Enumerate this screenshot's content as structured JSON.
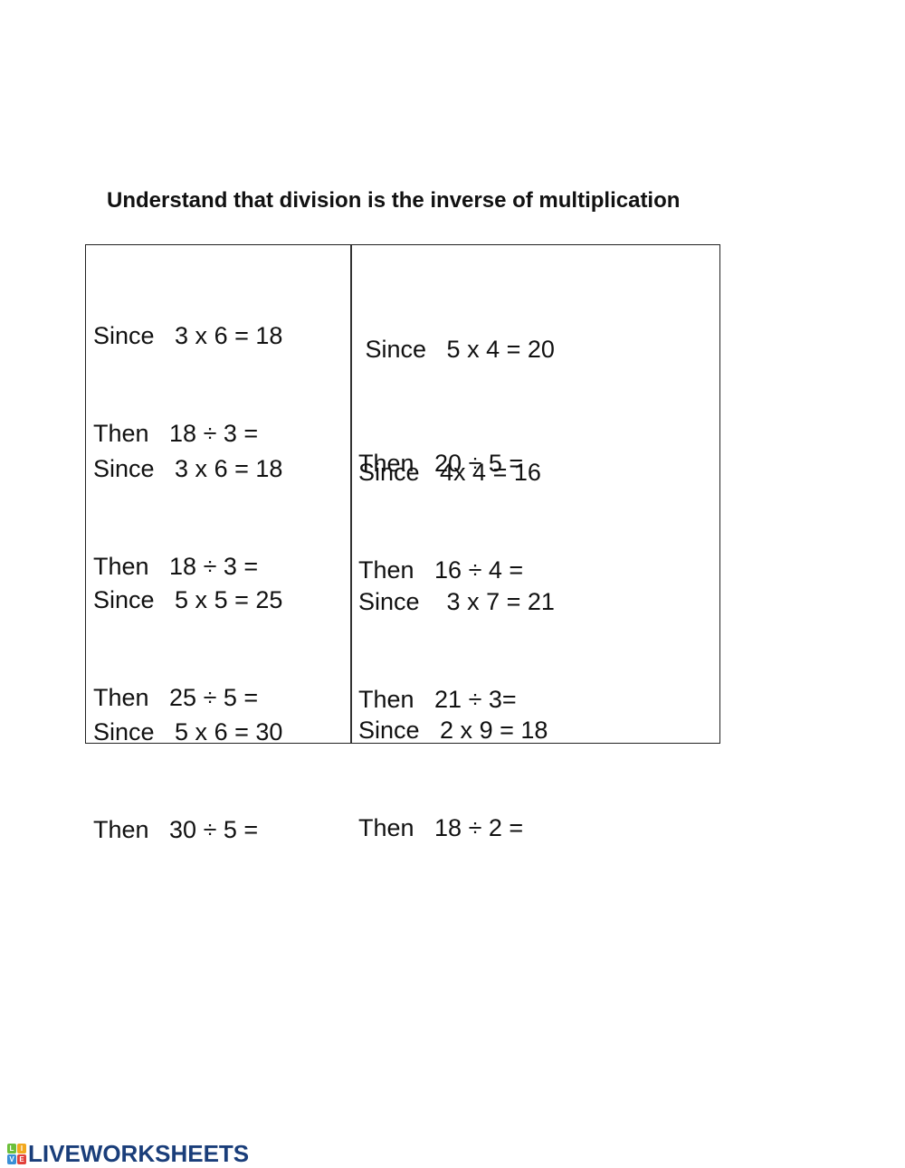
{
  "worksheet": {
    "title": "Understand that division is the inverse of multiplication",
    "left_column": [
      {
        "since": "Since   3 x 6 = 18",
        "then": "Then   18 ÷ 3 ="
      },
      {
        "since": "Since   3 x 6 = 18",
        "then": "Then   18 ÷ 3 ="
      },
      {
        "since": "Since   5 x 5 = 25",
        "then": "Then   25 ÷ 5 ="
      },
      {
        "since": "Since   5 x 6 = 30",
        "then": "Then   30 ÷ 5 ="
      }
    ],
    "right_column": [
      {
        "since": " Since   5 x 4 = 20",
        "then": "Then   20 ÷ 5 ="
      },
      {
        "since": "Since   4x 4 = 16",
        "then": "Then   16 ÷ 4 ="
      },
      {
        "since": "Since    3 x 7 = 21",
        "then": "Then   21 ÷ 3="
      },
      {
        "since": "Since   2 x 9 = 18",
        "then": "Then   18 ÷ 2 ="
      }
    ]
  },
  "footer": {
    "logo_text": "LIVEWORKSHEETS",
    "logo_letters": [
      "L",
      "I",
      "V",
      "E"
    ],
    "logo_colors": [
      "#6cbf3a",
      "#f2a81d",
      "#3a8fd6",
      "#e2403a"
    ]
  }
}
